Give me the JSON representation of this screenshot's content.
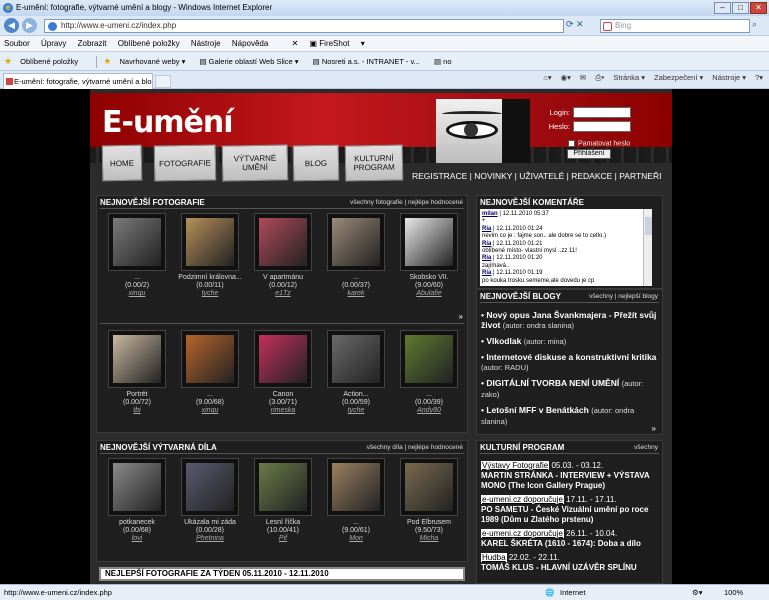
{
  "browser": {
    "window_title": "E-umění: fotografie, výtvarné umění a blogy - Windows Internet Explorer",
    "url": "http://www.e-umeni.cz/index.php",
    "search_placeholder": "Bing",
    "menu": [
      "Soubor",
      "Úpravy",
      "Zobrazit",
      "Oblíbené položky",
      "Nástroje",
      "Nápověda"
    ],
    "toolbar_extra": "FireShot",
    "favorites_label": "Oblíbené položky",
    "favorites": [
      "Navrhované weby ▾",
      "Galerie oblastí Web Slice ▾",
      "Nosreti a.s. - INTRANET - v...",
      "no"
    ],
    "tab_title": "E-umění: fotografie, výtvarné umění a blogy",
    "command_bar": [
      "Stránka ▾",
      "Zabezpečení ▾",
      "Nástroje ▾"
    ],
    "status_url": "http://www.e-umeni.cz/index.php",
    "status_zone": "Internet",
    "status_zoom": "100%"
  },
  "site": {
    "logo": "E-umění",
    "login": {
      "login_label": "Login:",
      "password_label": "Heslo:",
      "remember_label": "Pamatovat heslo",
      "submit_label": "Přihlášení"
    },
    "nav_tabs": [
      "HOME",
      "FOTOGRAFIE",
      "VÝTVARNÉ UMĚNÍ",
      "BLOG",
      "KULTURNÍ PROGRAM"
    ],
    "subnav": [
      "REGISTRACE",
      "NOVINKY",
      "UŽIVATELÉ",
      "REDAKCE",
      "PARTNEŘI"
    ],
    "photos": {
      "title": "NEJNOVĚJŠÍ FOTOGRAFIE",
      "links": "všechny fotografie | nejlépe hodnocené",
      "items": [
        {
          "title": "...",
          "rating": "(0.00/2)",
          "author": "xinqu",
          "color": "#7a7a7a"
        },
        {
          "title": "Podzimní královna...",
          "rating": "(0.00/11)",
          "author": "tyche",
          "color": "#b7905b"
        },
        {
          "title": "V apartmánu",
          "rating": "(0.00/12)",
          "author": "e1Tz",
          "color": "#b04a5a"
        },
        {
          "title": "...",
          "rating": "(0.00/37)",
          "author": "karek",
          "color": "#9a8a78"
        },
        {
          "title": "Skobsko VII.",
          "rating": "(9.00/60)",
          "author": "Abulafie",
          "color": "#e8e8e8"
        },
        {
          "title": "Portrét",
          "rating": "(0.00/72)",
          "author": "tbi",
          "color": "#c8b8a0"
        },
        {
          "title": "...",
          "rating": "(9.00/68)",
          "author": "xinqu",
          "color": "#b8662c"
        },
        {
          "title": "Canon",
          "rating": "(3.00/71)",
          "author": "rimeska",
          "color": "#c43060"
        },
        {
          "title": "Action...",
          "rating": "(0.00/59)",
          "author": "tyche",
          "color": "#6a6a6a"
        },
        {
          "title": "...",
          "rating": "(0.00/39)",
          "author": "Andy80",
          "color": "#5e7a30"
        }
      ]
    },
    "artworks": {
      "title": "NEJNOVĚJŠÍ VÝTVARNÁ DÍLA",
      "links": "všechny díla | nejlépe hodnocené",
      "items": [
        {
          "title": "potkanecek",
          "rating": "(0.00/68)",
          "author": "lovi",
          "color": "#8a8a8a"
        },
        {
          "title": "Ukázala mi záda",
          "rating": "(0.00/28)",
          "author": "Phetnina",
          "color": "#5a5a70"
        },
        {
          "title": "Lesní říčka",
          "rating": "(10.00/41)",
          "author": "Pif",
          "color": "#6a7a48"
        },
        {
          "title": "...",
          "rating": "(9.00/61)",
          "author": "Mon",
          "color": "#9a8060"
        },
        {
          "title": "Pod Elbrusem",
          "rating": "(9.50/73)",
          "author": "Micha",
          "color": "#7a6a50"
        }
      ]
    },
    "week_bar": "NEJLEPŠÍ FOTOGRAFIE ZA TÝDEN 05.11.2010 - 12.11.2010",
    "comments": {
      "title": "NEJNOVĚJŠÍ KOMENTÁŘE",
      "entries": [
        {
          "user": "milan",
          "date": "| 12.11.2010 05:37",
          "text": "+"
        },
        {
          "user": "Ria",
          "date": "| 12.11.2010 01:24",
          "text": "nevim co je : fajme son.. ale dobre se to cetlo.)"
        },
        {
          "user": "Ria",
          "date": "| 12.11.2010 01:21",
          "text": "oblíbené místo- vlastní mysl ..zz 11!"
        },
        {
          "user": "Ria",
          "date": "| 12.11.2010 01:20",
          "text": "zajímavá.."
        },
        {
          "user": "Ria",
          "date": "| 12.11.2010 01:19",
          "text": "po kouka trosku sememe,ale dovedu je cp"
        }
      ]
    },
    "blogs": {
      "title": "NEJNOVĚJŠÍ BLOGY",
      "links": "všechny | nejlepší blogy",
      "items": [
        {
          "title": "Nový opus Jana Švankmajera - Přežít svůj život",
          "author": "(autor: ondra slanina)"
        },
        {
          "title": "Vlkodlak",
          "author": "(autor: mina)"
        },
        {
          "title": "Internetové diskuse a konstruktivní kritika",
          "author": "(autor: RADU)"
        },
        {
          "title": "DIGITÁLNÍ TVORBA NENÍ UMĚNÍ",
          "author": "(autor: zako)"
        },
        {
          "title": "Letošní MFF v Benátkách",
          "author": "(autor: ondra slanina)"
        }
      ]
    },
    "culture": {
      "title": "KULTURNÍ PROGRAM",
      "links": "všechny",
      "items": [
        {
          "tag": "Výstavy Fotografie",
          "date": "05.03. - 03.12.",
          "text": "MARTIN STRÁNKA - INTERVIEW + VÝSTAVA MONO (The Icon Gallery Prague)"
        },
        {
          "tag": "e-umeni.cz doporučuje",
          "date": "17.11. - 17.11.",
          "text": "PO SAMETU - České Vizuální umění po roce 1989 (Dům u Zlatého prstenu)"
        },
        {
          "tag": "e-umeni.cz doporučuje",
          "date": "26.11. - 10.04.",
          "text": "KAREL ŠKRÉTA (1610 - 1674): Doba a dílo"
        },
        {
          "tag": "Hudba",
          "date": "22.02. - 22.11.",
          "text": "TOMÁŠ KLUS - HLAVNÍ UZÁVĚR SPLÍNU"
        }
      ]
    }
  }
}
